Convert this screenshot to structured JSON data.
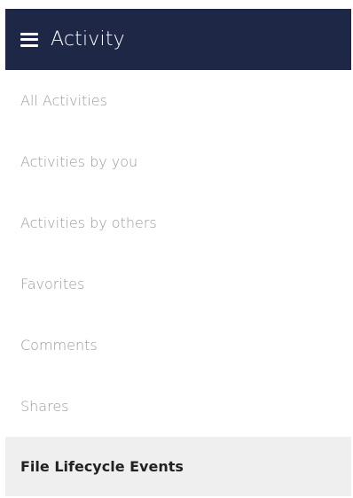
{
  "header": {
    "title": "Activity",
    "menu_icon": "hamburger-menu-icon",
    "background": "#1e2745"
  },
  "menu": {
    "items": [
      {
        "label": "All Activities"
      },
      {
        "label": "Activities by you"
      },
      {
        "label": "Activities by others"
      },
      {
        "label": "Favorites"
      },
      {
        "label": "Comments"
      },
      {
        "label": "Shares"
      },
      {
        "label": "File Lifecycle Events",
        "active": true
      }
    ]
  }
}
